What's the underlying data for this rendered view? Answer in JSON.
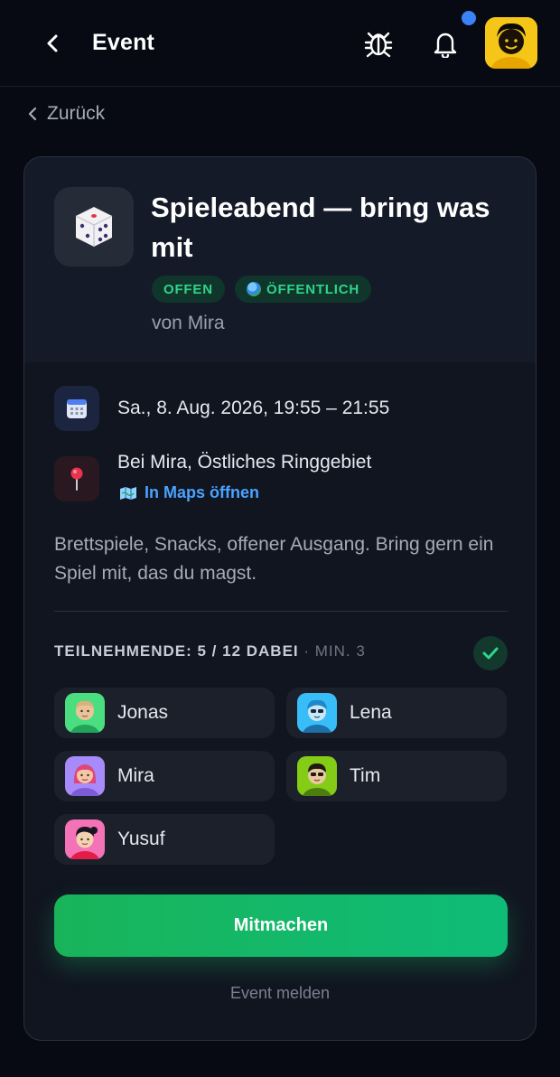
{
  "header": {
    "title": "Event",
    "back_icon": "chevron-left-icon",
    "bug_icon": "bug-icon",
    "bell_icon": "bell-icon",
    "has_notification": true,
    "avatar_color": "#f5c518"
  },
  "back_link": {
    "label": "Zurück"
  },
  "event": {
    "icon": "dice-icon",
    "title": "Spieleabend — bring was mit",
    "badges": {
      "status": "OFFEN",
      "visibility": "ÖFFENTLICH"
    },
    "author": "von Mira",
    "date": "Sa., 8. Aug. 2026, 19:55 – 21:55",
    "location": "Bei Mira, Östliches Ringgebiet",
    "maps_link": "In Maps öffnen",
    "description": "Brettspiele, Snacks, offener Ausgang. Bring gern ein Spiel mit, das du magst."
  },
  "participants": {
    "label": "TEILNEHMENDE: 5 / 12 DABEI",
    "min_label": " · MIN. 3",
    "minimum_reached": true,
    "people": [
      {
        "name": "Jonas",
        "color": "#4ade80"
      },
      {
        "name": "Lena",
        "color": "#38bdf8"
      },
      {
        "name": "Mira",
        "color": "#a78bfa"
      },
      {
        "name": "Tim",
        "color": "#84cc16"
      },
      {
        "name": "Yusuf",
        "color": "#f472b6"
      }
    ]
  },
  "actions": {
    "join_label": "Mitmachen",
    "report_label": "Event melden"
  },
  "colors": {
    "background": "#070a12",
    "card": "#111520",
    "accent_green": "#19b45a",
    "badge_green": "#2fd58b",
    "link_blue": "#4aa3ff",
    "notification_blue": "#3b82f6"
  }
}
